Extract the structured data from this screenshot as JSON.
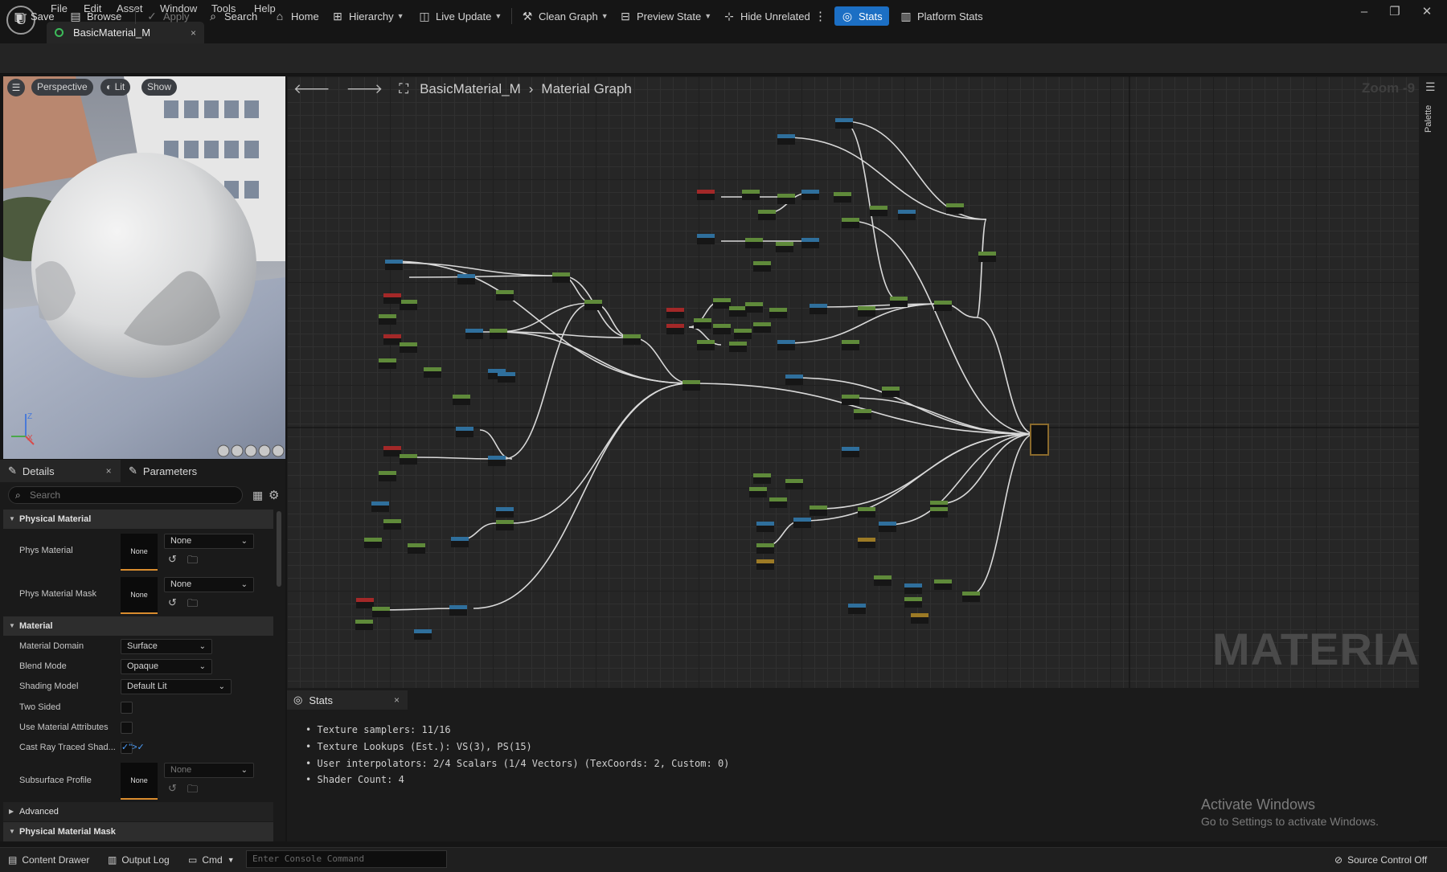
{
  "menu": [
    "File",
    "Edit",
    "Asset",
    "Window",
    "Tools",
    "Help"
  ],
  "doc_tab": {
    "title": "BasicMaterial_M",
    "close": "×"
  },
  "window_controls": {
    "minimize": "–",
    "restore": "❐",
    "close": "✕"
  },
  "toolbar": {
    "save": "Save",
    "browse": "Browse",
    "apply": "Apply",
    "search": "Search",
    "home": "Home",
    "hierarchy": "Hierarchy",
    "live_update": "Live Update",
    "clean_graph": "Clean Graph",
    "preview_state": "Preview State",
    "hide_unrelated": "Hide Unrelated",
    "stats": "Stats",
    "platform_stats": "Platform Stats"
  },
  "viewport": {
    "perspective": "Perspective",
    "lit": "Lit",
    "show": "Show",
    "axis_z": "Z",
    "axis_x": "X"
  },
  "panel_tabs": {
    "details": "Details",
    "parameters": "Parameters"
  },
  "details": {
    "search_placeholder": "Search",
    "sections": {
      "physical_material": "Physical Material",
      "material": "Material",
      "advanced": "Advanced",
      "physical_material_mask": "Physical Material Mask"
    },
    "phys_material": {
      "label": "Phys Material",
      "thumb": "None",
      "value": "None"
    },
    "phys_material_mask": {
      "label": "Phys Material Mask",
      "thumb": "None",
      "value": "None"
    },
    "material_domain": {
      "label": "Material Domain",
      "value": "Surface"
    },
    "blend_mode": {
      "label": "Blend Mode",
      "value": "Opaque"
    },
    "shading_model": {
      "label": "Shading Model",
      "value": "Default Lit"
    },
    "two_sided": {
      "label": "Two Sided",
      "checked": false
    },
    "use_material_attributes": {
      "label": "Use Material Attributes",
      "checked": false
    },
    "cast_ray_traced": {
      "label": "Cast Ray Traced Shad...",
      "checked": true
    },
    "subsurface_profile": {
      "label": "Subsurface Profile",
      "thumb": "None",
      "value": "None"
    }
  },
  "graph": {
    "breadcrumb_root": "BasicMaterial_M",
    "breadcrumb_page": "Material Graph",
    "zoom": "Zoom -9",
    "watermark": "MATERIAL",
    "palette": "Palette"
  },
  "stats": {
    "tab": "Stats",
    "lines": [
      "Texture samplers: 11/16",
      "Texture Lookups (Est.): VS(3), PS(15)",
      "User interpolators: 2/4 Scalars (1/4 Vectors) (TexCoords: 2, Custom: 0)",
      "Shader Count: 4"
    ]
  },
  "activate": {
    "title": "Activate Windows",
    "subtitle": "Go to Settings to activate Windows."
  },
  "statusbar": {
    "content_drawer": "Content Drawer",
    "output_log": "Output Log",
    "cmd": "Cmd",
    "console_placeholder": "Enter Console Command",
    "source_control": "Source Control Off"
  },
  "colors": {
    "accent": "#1c6fc4",
    "node_green": "#5f8a3a",
    "node_blue": "#2f6f9c",
    "node_red": "#a32828",
    "node_yellow": "#9c7a25",
    "wire": "#d9d9d9"
  }
}
